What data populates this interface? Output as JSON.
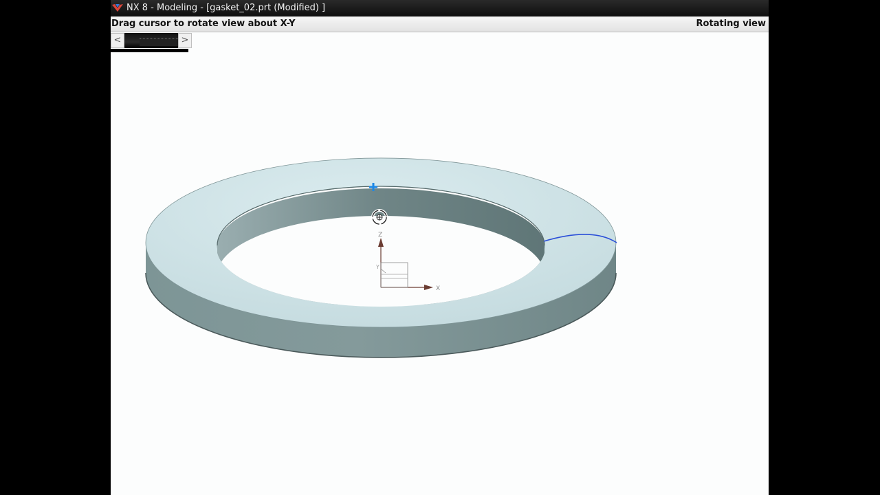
{
  "window": {
    "title": "NX 8 - Modeling - [gasket_02.prt (Modified) ]",
    "logo_icon": "nx-logo-icon"
  },
  "cue_line": {
    "prompt": "Drag cursor to rotate view about X-Y",
    "status": "Rotating view"
  },
  "navigator": {
    "prev_label": "<",
    "next_label": ">"
  },
  "viewport": {
    "background": "#fcfdfd",
    "part": "gasket ring",
    "top_face_color": "#cfe3e7",
    "side_color": "#7f9697",
    "selected_edge_color": "#2b4fd8",
    "rotate_cursor_icon": "rotate-view-icon",
    "center_marker_icon": "rotation-point-icon",
    "triad_labels": {
      "x": "X",
      "y": "Y",
      "z": "Z"
    }
  }
}
